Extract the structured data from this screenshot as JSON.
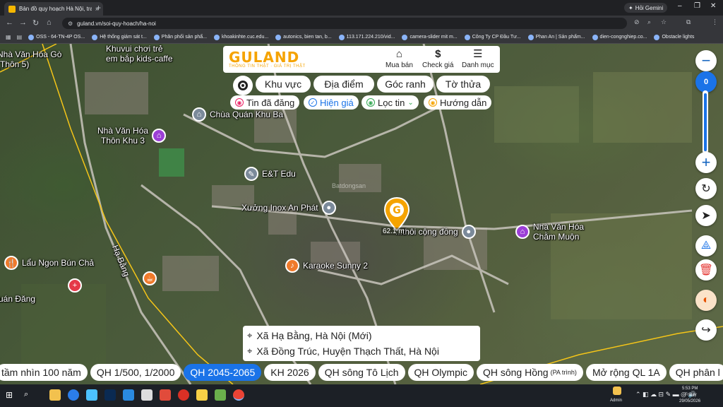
{
  "browser": {
    "tab_title": "Bản đồ quy hoạch Hà Nội, tra c...",
    "tab_close": "×",
    "new_tab": "+",
    "gemini_label": "Hỏi Gemini",
    "url": "guland.vn/soi-quy-hoach/ha-noi",
    "bookmarks": [
      "OSS - 64-TN-4P OS...",
      "Hệ thống giám sát t...",
      "Phân phối sản phẩ...",
      "khoakinhte.cuc.edu...",
      "autonics, bien tan, b...",
      "113.171.224.210/vid...",
      "camera-slider mit m...",
      "Công Ty CP Đầu Tư...",
      "Phan An | Sản phẩm...",
      "dien-congnghiep.co...",
      "Obstacle lights"
    ]
  },
  "header": {
    "logo_main": "GULAND",
    "logo_sub": "THÔNG TIN THẬT · GIÁ TRỊ THẬT",
    "actions": [
      {
        "icon": "house-icon",
        "glyph": "⌂",
        "label": "Mua bán"
      },
      {
        "icon": "dollar-icon",
        "glyph": "$",
        "label": "Check giá"
      },
      {
        "icon": "menu-icon",
        "glyph": "☰",
        "label": "Danh mục"
      }
    ]
  },
  "search_tabs": [
    "Khu vực",
    "Địa điểm",
    "Góc ranh",
    "Tờ thửa"
  ],
  "filter_chips": [
    {
      "label": "Tin đã đăng",
      "color": "#e91e63",
      "glyph": "◉"
    },
    {
      "label": "Hiện giá",
      "color": "#1a73e8",
      "glyph": "✓"
    },
    {
      "label": "Lọc tin",
      "color": "#34a853",
      "glyph": "◉",
      "caret": "⌄"
    },
    {
      "label": "Hướng dẫn",
      "color": "#f5a300",
      "glyph": "◉"
    }
  ],
  "map": {
    "pois": [
      {
        "name": "Nhà Văn Hóa Gò\n(Thôn 5)"
      },
      {
        "name": "Khuvui chơi trẻ\nem bắp kids-caffe"
      },
      {
        "name": "Chùa Quán Khu Ba"
      },
      {
        "name": "Nhà Văn Hóa\nThôn Khu 3"
      },
      {
        "name": "E&T Edu"
      },
      {
        "name": "Xưởng Inox An Phát"
      },
      {
        "name": "...thôi cộng đồng"
      },
      {
        "name": "Nhà Văn Hóa\nChằm Muộn"
      },
      {
        "name": "Lẩu Ngon Bún Chả"
      },
      {
        "name": "Karaoke Sunny 2"
      },
      {
        "name": "uán Đăng"
      }
    ],
    "road_label": "Hạ Bằng",
    "watermark": "Batdongsan",
    "marker_distance": "62.1 m"
  },
  "controls": {
    "zoom_out": "−",
    "zoom_value": "0",
    "zoom_in": "+"
  },
  "address": {
    "new": "Xã Hạ Bằng, Hà Nội (Mới)",
    "old": "Xã Đồng Trúc, Huyện Thạch Thất, Hà Nội"
  },
  "plan_tabs": [
    {
      "label": "tầm nhìn 100 năm",
      "active": false
    },
    {
      "label": "QH 1/500, 1/2000",
      "active": false
    },
    {
      "label": "QH 2045-2065",
      "active": true
    },
    {
      "label": "KH 2026",
      "active": false
    },
    {
      "label": "QH sông Tô Lịch",
      "active": false
    },
    {
      "label": "QH Olympic",
      "active": false
    },
    {
      "label": "QH sông Hồng",
      "note": "(PA trình)",
      "active": false
    },
    {
      "label": "Mở rộng QL 1A",
      "active": false
    },
    {
      "label": "QH phân l",
      "active": false
    }
  ],
  "taskbar": {
    "user": "Admin",
    "time": "5:53 PM",
    "day": "Friday",
    "date": "29/05/2026"
  }
}
